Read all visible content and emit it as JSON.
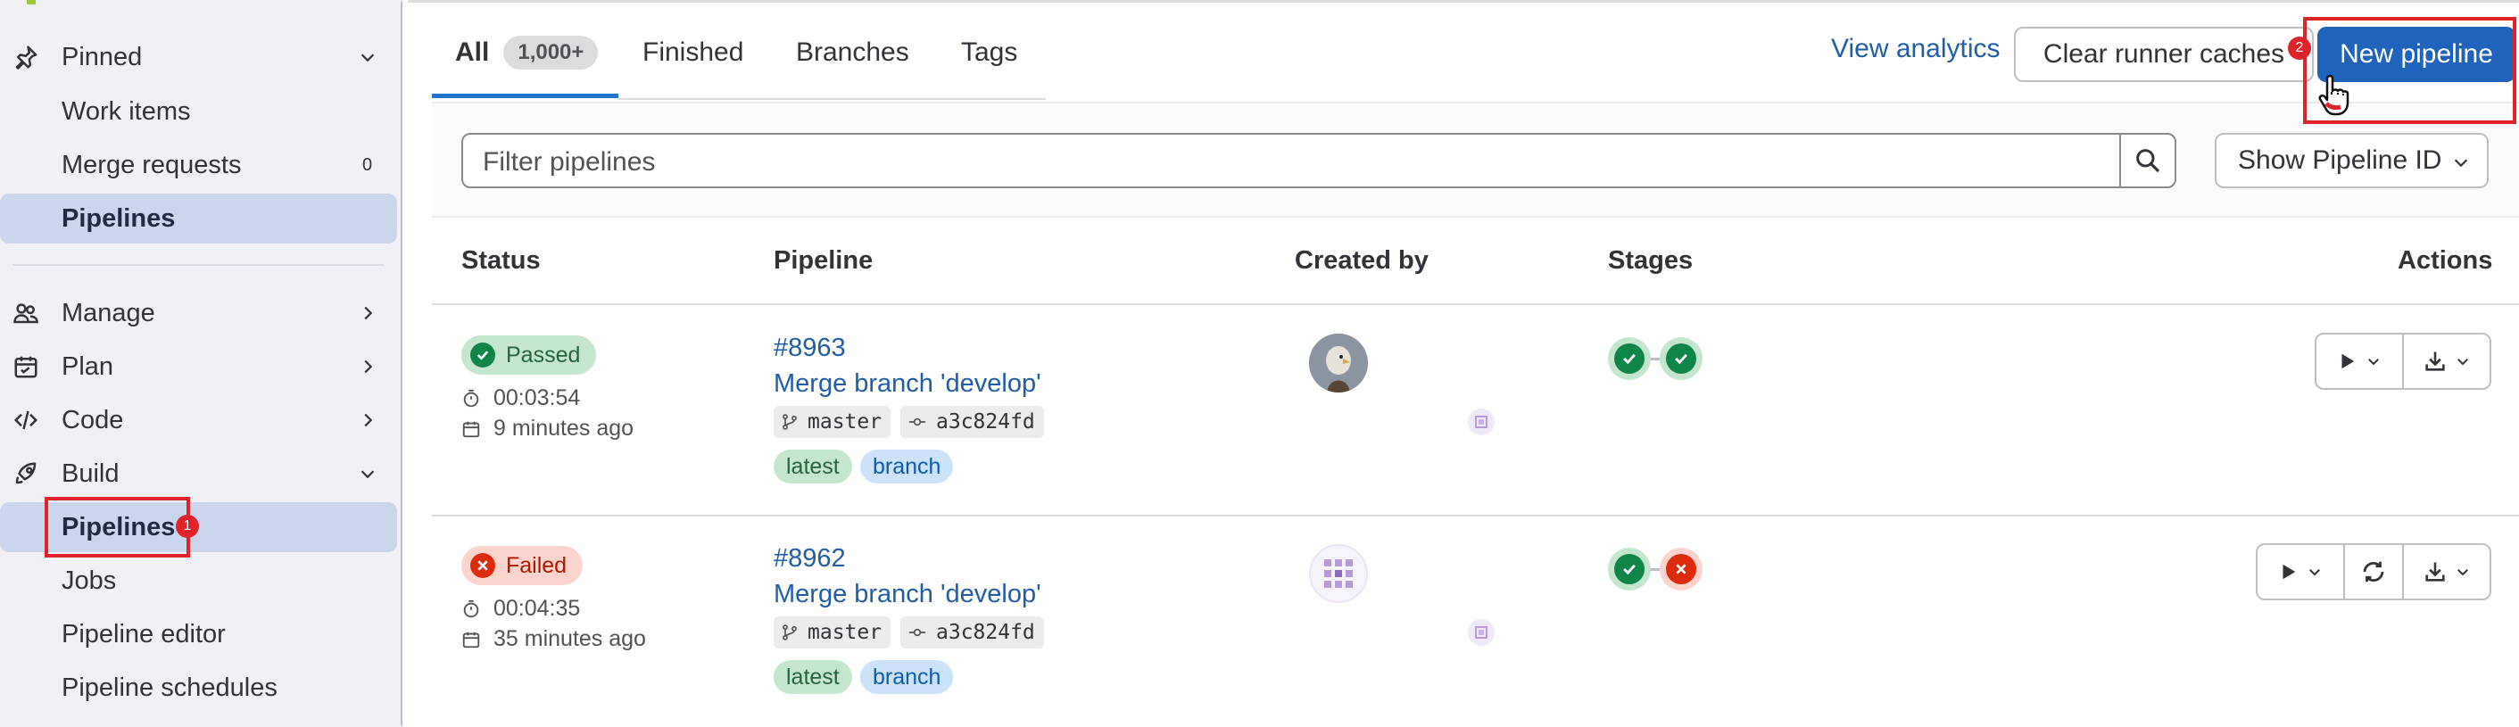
{
  "sidebar": {
    "items": [
      {
        "label": "Pinned",
        "icon": "pin-icon",
        "chevron": "down"
      },
      {
        "label": "Work items"
      },
      {
        "label": "Merge requests",
        "count": "0"
      },
      {
        "label": "Pipelines",
        "active": true
      },
      {
        "label": "Manage",
        "icon": "users-icon",
        "chevron": "right"
      },
      {
        "label": "Plan",
        "icon": "calendar-icon",
        "chevron": "right"
      },
      {
        "label": "Code",
        "icon": "code-icon",
        "chevron": "right"
      },
      {
        "label": "Build",
        "icon": "rocket-icon",
        "chevron": "down"
      },
      {
        "label": "Pipelines",
        "active": true
      },
      {
        "label": "Jobs"
      },
      {
        "label": "Pipeline editor"
      },
      {
        "label": "Pipeline schedules"
      }
    ],
    "annotation_badge": "1"
  },
  "tabs": [
    {
      "label": "All",
      "badge": "1,000+",
      "active": true
    },
    {
      "label": "Finished"
    },
    {
      "label": "Branches"
    },
    {
      "label": "Tags"
    }
  ],
  "header": {
    "view_analytics": "View analytics",
    "clear_caches": "Clear runner caches",
    "new_pipeline": "New pipeline",
    "annotation_badge": "2"
  },
  "filter": {
    "placeholder": "Filter pipelines",
    "show_id": "Show Pipeline ID"
  },
  "table": {
    "headers": [
      "Status",
      "Pipeline",
      "Created by",
      "Stages",
      "Actions"
    ],
    "rows": [
      {
        "status": "Passed",
        "duration": "00:03:54",
        "time_ago": "9 minutes ago",
        "id": "#8963",
        "title": "Merge branch 'develop'",
        "ref": "master",
        "commit": "a3c824fd",
        "tags": [
          "latest",
          "branch"
        ]
      },
      {
        "status": "Failed",
        "duration": "00:04:35",
        "time_ago": "35 minutes ago",
        "id": "#8962",
        "title": "Merge branch 'develop'",
        "ref": "master",
        "commit": "a3c824fd",
        "tags": [
          "latest",
          "branch"
        ]
      }
    ]
  },
  "colors": {
    "accent": "#1f63bd",
    "link": "#1f5da8",
    "success": "#108548",
    "danger": "#dd2b0e",
    "annotation": "#e0232b"
  }
}
